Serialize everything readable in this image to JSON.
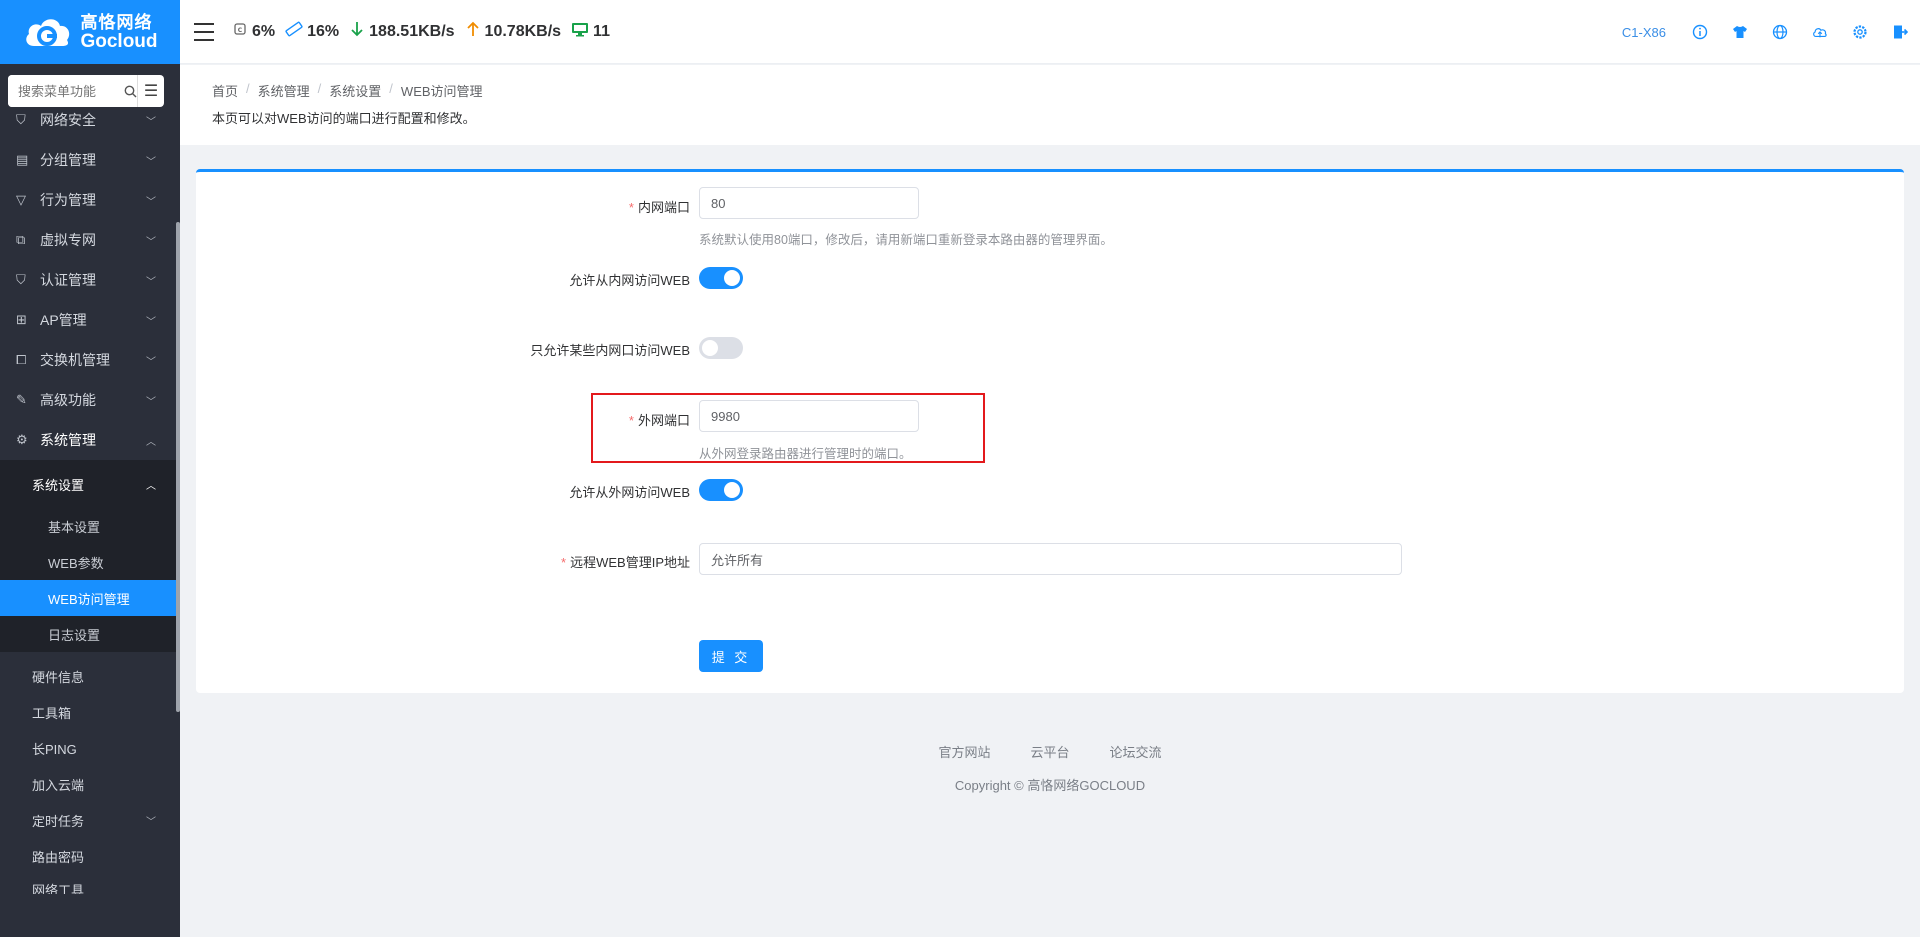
{
  "brand": {
    "cn": "高恪网络",
    "en": "Gocloud",
    "color": "#1890ff"
  },
  "sidebar": {
    "search_placeholder": "搜索菜单功能",
    "items": [
      {
        "label": "网络安全",
        "icon": "shield-icon"
      },
      {
        "label": "分组管理",
        "icon": "list-icon"
      },
      {
        "label": "行为管理",
        "icon": "filter-icon"
      },
      {
        "label": "虚拟专网",
        "icon": "network-icon"
      },
      {
        "label": "认证管理",
        "icon": "check-shield-icon"
      },
      {
        "label": "AP管理",
        "icon": "sitemap-icon"
      },
      {
        "label": "交换机管理",
        "icon": "copy-icon"
      },
      {
        "label": "高级功能",
        "icon": "pin-icon"
      },
      {
        "label": "系统管理",
        "icon": "gear-icon"
      }
    ],
    "system_settings": {
      "label": "系统设置",
      "children": [
        "基本设置",
        "WEB参数",
        "WEB访问管理",
        "日志设置"
      ],
      "selected": "WEB访问管理"
    },
    "more_items": [
      "硬件信息",
      "工具箱",
      "长PING",
      "加入云端",
      "定时任务",
      "路由密码",
      "网络工具"
    ]
  },
  "header": {
    "cpu": "6%",
    "mem": "16%",
    "down": "188.51KB/s",
    "up": "10.78KB/s",
    "clients": "11",
    "model": "C1-X86",
    "icons": [
      "info-icon",
      "shirt-icon",
      "globe-icon",
      "cloud-upload-icon",
      "gear-icon",
      "logout-icon"
    ]
  },
  "breadcrumb": {
    "items": [
      "首页",
      "系统管理",
      "系统设置",
      "WEB访问管理"
    ],
    "description": "本页可以对WEB访问的端口进行配置和修改。"
  },
  "form": {
    "lan_port_label": "内网端口",
    "lan_port_value": "80",
    "lan_port_hint": "系统默认使用80端口，修改后，请用新端口重新登录本路由器的管理界面。",
    "allow_lan_label": "允许从内网访问WEB",
    "allow_lan_on": true,
    "only_some_lan_label": "只允许某些内网口访问WEB",
    "only_some_lan_on": false,
    "wan_port_label": "外网端口",
    "wan_port_value": "9980",
    "wan_port_hint": "从外网登录路由器进行管理时的端口。",
    "allow_wan_label": "允许从外网访问WEB",
    "allow_wan_on": true,
    "remote_ip_label": "远程WEB管理IP地址",
    "remote_ip_value": "允许所有",
    "submit_label": "提 交"
  },
  "footer": {
    "links": [
      "官方网站",
      "云平台",
      "论坛交流"
    ],
    "copyright": "Copyright © 高恪网络GOCLOUD"
  }
}
